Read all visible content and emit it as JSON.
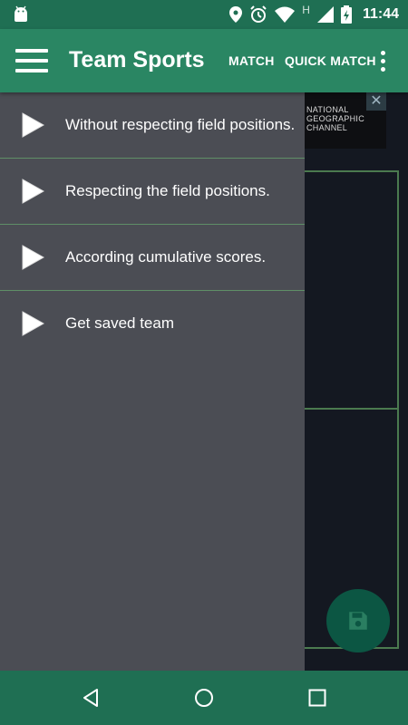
{
  "status_bar": {
    "time": "11:44",
    "network_type": "H",
    "icons": [
      "android-icon",
      "location-icon",
      "alarm-icon",
      "wifi-icon",
      "signal-icon",
      "battery-icon"
    ]
  },
  "app_bar": {
    "title": "Team Sports",
    "actions": [
      "MATCH",
      "QUICK MATCH"
    ]
  },
  "ad": {
    "text_line1": "NATIONAL",
    "text_line2": "GEOGRAPHIC",
    "text_line3": "CHANNEL",
    "close": "✕"
  },
  "drawer": {
    "items": [
      {
        "label": "Without respecting field positions."
      },
      {
        "label": "Respecting the field positions."
      },
      {
        "label": "According cumulative scores."
      },
      {
        "label": "Get saved team"
      }
    ]
  },
  "colors": {
    "status_bar": "#1f6f53",
    "app_bar": "#2a8663",
    "drawer": "#4b4d54",
    "divider": "#5f8f67",
    "fab": "#0c5643"
  }
}
